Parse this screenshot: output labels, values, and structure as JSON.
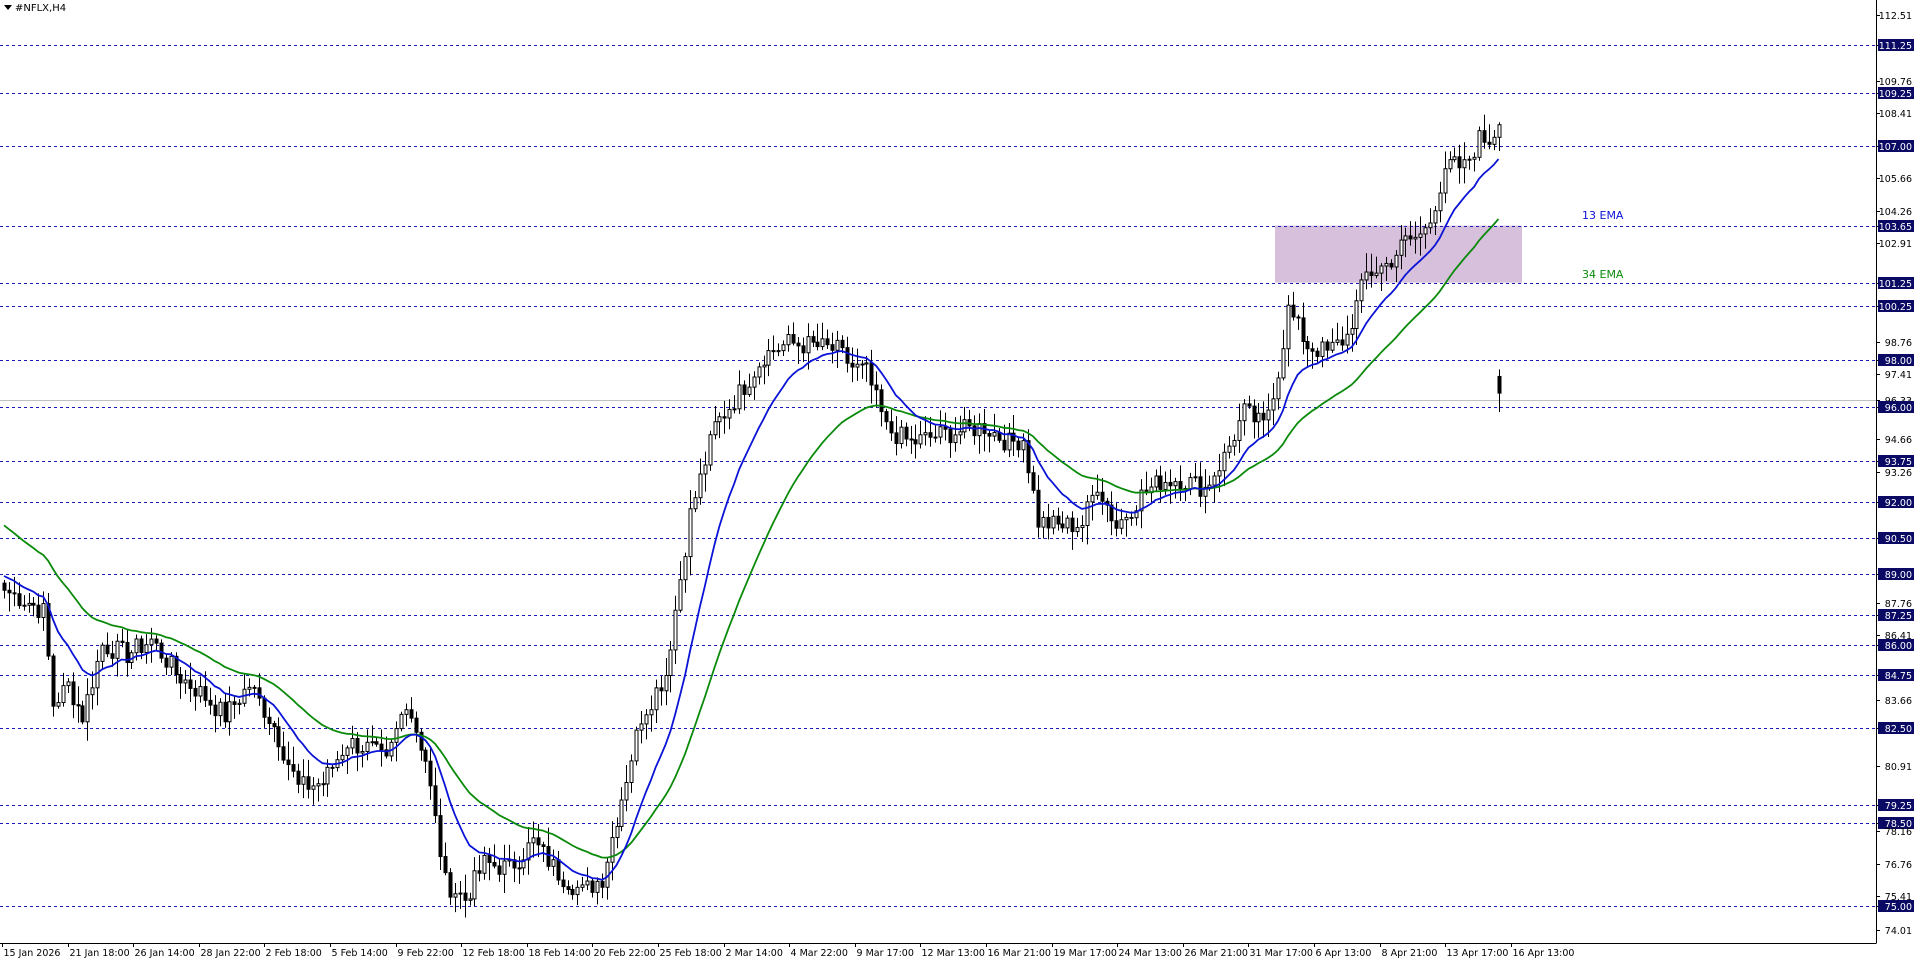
{
  "window": {
    "title": "#NFLX,H4",
    "menu_icon": "dropdown-triangle-icon"
  },
  "colors": {
    "background": "#ffffff",
    "axis": "#000000",
    "level_line": "#1a1ab4",
    "level_label_bg": "#0a0a64",
    "level_label_text": "#ffffff",
    "bull_body": "#ffffff",
    "bear_body": "#000000",
    "ema13": "#0b13d6",
    "ema34": "#0a8a0a",
    "zone_fill": "#d7c0db",
    "current_price_line": "#c0c0c0"
  },
  "chart_data": {
    "type": "candlestick",
    "symbol": "#NFLX",
    "timeframe": "H4",
    "y_range": [
      73.45,
      113.15
    ],
    "price_axis_ticks": [
      "112.51",
      "111.25",
      "109.76",
      "109.25",
      "108.41",
      "107.00",
      "105.66",
      "104.26",
      "103.65",
      "102.91",
      "101.25",
      "100.25",
      "98.76",
      "98.00",
      "97.41",
      "96.33",
      "96.00",
      "94.66",
      "93.75",
      "93.26",
      "92.00",
      "90.50",
      "89.00",
      "87.76",
      "87.25",
      "86.41",
      "86.00",
      "84.75",
      "83.66",
      "82.50",
      "80.91",
      "79.25",
      "78.50",
      "78.16",
      "76.76",
      "75.41",
      "75.00",
      "74.01"
    ],
    "time_axis_labels": [
      "15 Jan 2026",
      "21 Jan 18:00",
      "26 Jan 14:00",
      "28 Jan 22:00",
      "2 Feb 18:00",
      "5 Feb 14:00",
      "9 Feb 22:00",
      "12 Feb 18:00",
      "18 Feb 14:00",
      "20 Feb 22:00",
      "25 Feb 18:00",
      "2 Mar 14:00",
      "4 Mar 22:00",
      "9 Mar 17:00",
      "12 Mar 13:00",
      "16 Mar 21:00",
      "19 Mar 17:00",
      "24 Mar 13:00",
      "26 Mar 21:00",
      "31 Mar 17:00",
      "6 Apr 13:00",
      "8 Apr 21:00",
      "13 Apr 17:00",
      "16 Apr 13:00"
    ],
    "horizontal_levels": [
      "111.25",
      "109.25",
      "107.00",
      "103.65",
      "101.25",
      "100.25",
      "98.00",
      "96.00",
      "93.75",
      "92.00",
      "90.50",
      "89.00",
      "87.25",
      "86.00",
      "84.75",
      "82.50",
      "79.25",
      "78.50",
      "75.00"
    ],
    "current_price": 96.33,
    "zone": {
      "from": 101.25,
      "to": 103.65
    },
    "anchors": [
      [
        0,
        88.3
      ],
      [
        5,
        87.8
      ],
      [
        8,
        87.4
      ],
      [
        10,
        83.5
      ],
      [
        13,
        84.3
      ],
      [
        16,
        83.0
      ],
      [
        20,
        86.0
      ],
      [
        25,
        85.6
      ],
      [
        30,
        86.2
      ],
      [
        35,
        84.8
      ],
      [
        40,
        84.0
      ],
      [
        45,
        83.0
      ],
      [
        50,
        84.3
      ],
      [
        55,
        82.6
      ],
      [
        60,
        80.0
      ],
      [
        65,
        80.2
      ],
      [
        70,
        81.9
      ],
      [
        75,
        81.6
      ],
      [
        78,
        81.0
      ],
      [
        82,
        83.7
      ],
      [
        86,
        81.2
      ],
      [
        90,
        76.0
      ],
      [
        94,
        75.3
      ],
      [
        98,
        76.8
      ],
      [
        103,
        76.6
      ],
      [
        108,
        77.7
      ],
      [
        113,
        76.4
      ],
      [
        118,
        75.6
      ],
      [
        122,
        76.2
      ],
      [
        126,
        79.6
      ],
      [
        130,
        83.0
      ],
      [
        135,
        84.8
      ],
      [
        140,
        91.5
      ],
      [
        145,
        95.2
      ],
      [
        150,
        96.6
      ],
      [
        155,
        98.2
      ],
      [
        160,
        98.7
      ],
      [
        165,
        98.6
      ],
      [
        170,
        98.4
      ],
      [
        173,
        97.7
      ],
      [
        176,
        97.5
      ],
      [
        180,
        95.1
      ],
      [
        185,
        94.5
      ],
      [
        190,
        94.8
      ],
      [
        195,
        95.0
      ],
      [
        200,
        95.2
      ],
      [
        205,
        94.5
      ],
      [
        208,
        94.7
      ],
      [
        211,
        91.2
      ],
      [
        215,
        91.0
      ],
      [
        220,
        91.1
      ],
      [
        223,
        92.8
      ],
      [
        227,
        91.0
      ],
      [
        232,
        92.3
      ],
      [
        236,
        92.9
      ],
      [
        240,
        93.0
      ],
      [
        245,
        92.6
      ],
      [
        249,
        93.9
      ],
      [
        253,
        95.8
      ],
      [
        257,
        95.2
      ],
      [
        260,
        97.5
      ],
      [
        262,
        100.1
      ],
      [
        266,
        98.6
      ],
      [
        270,
        98.3
      ],
      [
        274,
        99.0
      ],
      [
        278,
        101.6
      ],
      [
        282,
        102.0
      ],
      [
        286,
        103.0
      ],
      [
        289,
        103.2
      ],
      [
        292,
        104.6
      ],
      [
        295,
        106.2
      ],
      [
        298,
        106.1
      ],
      [
        301,
        107.3
      ],
      [
        303,
        107.3
      ],
      [
        305,
        107.9
      ]
    ],
    "after_gap_candle": {
      "open": 97.3,
      "close": 96.6,
      "high": 97.6,
      "low": 95.8
    },
    "indicators": [
      {
        "name": "13 EMA",
        "period": 13,
        "color": "#0b13d6"
      },
      {
        "name": "34 EMA",
        "period": 34,
        "color": "#0a8a0a"
      }
    ],
    "legend": {
      "placement": "right-of-last-bar"
    }
  }
}
